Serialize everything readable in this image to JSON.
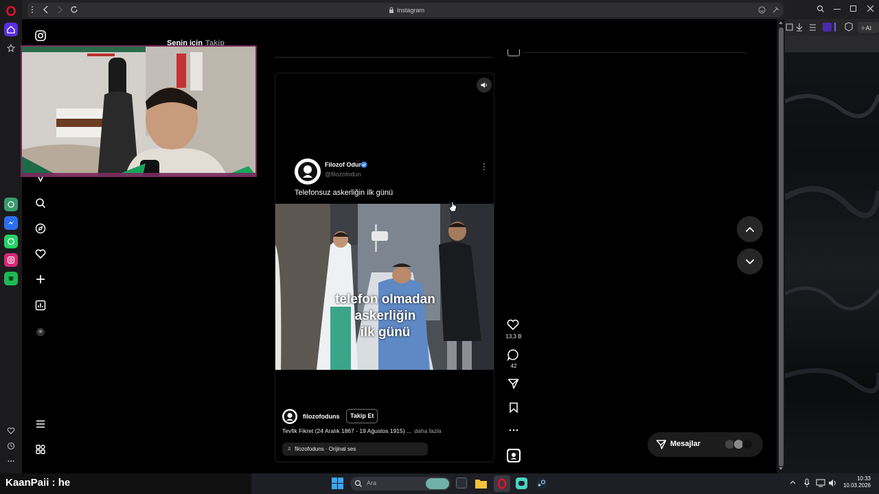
{
  "browser": {
    "url_title": "Instagram"
  },
  "instagram": {
    "tabs": [
      "Senin için",
      "Takip"
    ],
    "reel": {
      "author": "Filozof Odun",
      "handle": "@filozofodun",
      "caption_text": "Telefonsuz askerliğin ilk günü",
      "overlay_text": [
        "telefon olmadan",
        "askerliğin",
        "ilk günü"
      ],
      "poster_username": "filozofoduns",
      "follow_label": "Takip Et",
      "description": "Tevfik Fikret (24 Aralık 1867 - 19 Ağustos 1915) ...",
      "more_label": "daha fazla",
      "audio": "filozofoduns · Orijinal ses"
    },
    "actions": {
      "likes": "13,3 B",
      "comments": "42"
    },
    "messages": {
      "label": "Mesajlar"
    }
  },
  "chat": {
    "line": "KaanPaii : he"
  },
  "taskbar": {
    "search_placeholder": "Ara",
    "time": "10:33",
    "date": "10.03.2026"
  },
  "colors": {
    "opera_red": "#e0102b",
    "accent": "#6f3cf0",
    "page_bg": "#000000"
  }
}
